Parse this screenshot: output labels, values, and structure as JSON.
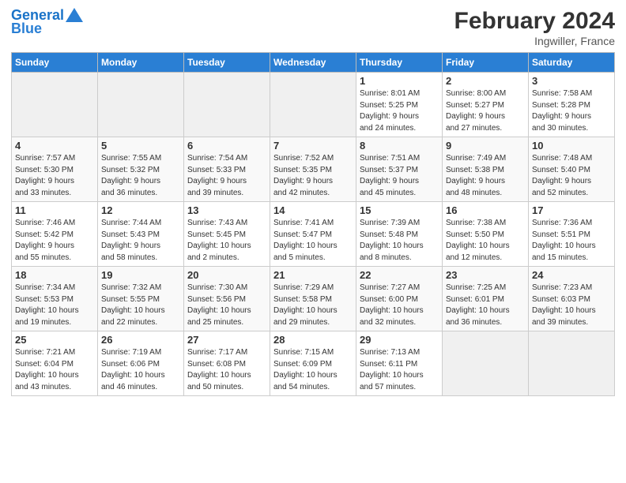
{
  "header": {
    "logo_line1": "General",
    "logo_line2": "Blue",
    "month_title": "February 2024",
    "location": "Ingwiller, France"
  },
  "days_of_week": [
    "Sunday",
    "Monday",
    "Tuesday",
    "Wednesday",
    "Thursday",
    "Friday",
    "Saturday"
  ],
  "weeks": [
    [
      {
        "day": "",
        "info": ""
      },
      {
        "day": "",
        "info": ""
      },
      {
        "day": "",
        "info": ""
      },
      {
        "day": "",
        "info": ""
      },
      {
        "day": "1",
        "info": "Sunrise: 8:01 AM\nSunset: 5:25 PM\nDaylight: 9 hours\nand 24 minutes."
      },
      {
        "day": "2",
        "info": "Sunrise: 8:00 AM\nSunset: 5:27 PM\nDaylight: 9 hours\nand 27 minutes."
      },
      {
        "day": "3",
        "info": "Sunrise: 7:58 AM\nSunset: 5:28 PM\nDaylight: 9 hours\nand 30 minutes."
      }
    ],
    [
      {
        "day": "4",
        "info": "Sunrise: 7:57 AM\nSunset: 5:30 PM\nDaylight: 9 hours\nand 33 minutes."
      },
      {
        "day": "5",
        "info": "Sunrise: 7:55 AM\nSunset: 5:32 PM\nDaylight: 9 hours\nand 36 minutes."
      },
      {
        "day": "6",
        "info": "Sunrise: 7:54 AM\nSunset: 5:33 PM\nDaylight: 9 hours\nand 39 minutes."
      },
      {
        "day": "7",
        "info": "Sunrise: 7:52 AM\nSunset: 5:35 PM\nDaylight: 9 hours\nand 42 minutes."
      },
      {
        "day": "8",
        "info": "Sunrise: 7:51 AM\nSunset: 5:37 PM\nDaylight: 9 hours\nand 45 minutes."
      },
      {
        "day": "9",
        "info": "Sunrise: 7:49 AM\nSunset: 5:38 PM\nDaylight: 9 hours\nand 48 minutes."
      },
      {
        "day": "10",
        "info": "Sunrise: 7:48 AM\nSunset: 5:40 PM\nDaylight: 9 hours\nand 52 minutes."
      }
    ],
    [
      {
        "day": "11",
        "info": "Sunrise: 7:46 AM\nSunset: 5:42 PM\nDaylight: 9 hours\nand 55 minutes."
      },
      {
        "day": "12",
        "info": "Sunrise: 7:44 AM\nSunset: 5:43 PM\nDaylight: 9 hours\nand 58 minutes."
      },
      {
        "day": "13",
        "info": "Sunrise: 7:43 AM\nSunset: 5:45 PM\nDaylight: 10 hours\nand 2 minutes."
      },
      {
        "day": "14",
        "info": "Sunrise: 7:41 AM\nSunset: 5:47 PM\nDaylight: 10 hours\nand 5 minutes."
      },
      {
        "day": "15",
        "info": "Sunrise: 7:39 AM\nSunset: 5:48 PM\nDaylight: 10 hours\nand 8 minutes."
      },
      {
        "day": "16",
        "info": "Sunrise: 7:38 AM\nSunset: 5:50 PM\nDaylight: 10 hours\nand 12 minutes."
      },
      {
        "day": "17",
        "info": "Sunrise: 7:36 AM\nSunset: 5:51 PM\nDaylight: 10 hours\nand 15 minutes."
      }
    ],
    [
      {
        "day": "18",
        "info": "Sunrise: 7:34 AM\nSunset: 5:53 PM\nDaylight: 10 hours\nand 19 minutes."
      },
      {
        "day": "19",
        "info": "Sunrise: 7:32 AM\nSunset: 5:55 PM\nDaylight: 10 hours\nand 22 minutes."
      },
      {
        "day": "20",
        "info": "Sunrise: 7:30 AM\nSunset: 5:56 PM\nDaylight: 10 hours\nand 25 minutes."
      },
      {
        "day": "21",
        "info": "Sunrise: 7:29 AM\nSunset: 5:58 PM\nDaylight: 10 hours\nand 29 minutes."
      },
      {
        "day": "22",
        "info": "Sunrise: 7:27 AM\nSunset: 6:00 PM\nDaylight: 10 hours\nand 32 minutes."
      },
      {
        "day": "23",
        "info": "Sunrise: 7:25 AM\nSunset: 6:01 PM\nDaylight: 10 hours\nand 36 minutes."
      },
      {
        "day": "24",
        "info": "Sunrise: 7:23 AM\nSunset: 6:03 PM\nDaylight: 10 hours\nand 39 minutes."
      }
    ],
    [
      {
        "day": "25",
        "info": "Sunrise: 7:21 AM\nSunset: 6:04 PM\nDaylight: 10 hours\nand 43 minutes."
      },
      {
        "day": "26",
        "info": "Sunrise: 7:19 AM\nSunset: 6:06 PM\nDaylight: 10 hours\nand 46 minutes."
      },
      {
        "day": "27",
        "info": "Sunrise: 7:17 AM\nSunset: 6:08 PM\nDaylight: 10 hours\nand 50 minutes."
      },
      {
        "day": "28",
        "info": "Sunrise: 7:15 AM\nSunset: 6:09 PM\nDaylight: 10 hours\nand 54 minutes."
      },
      {
        "day": "29",
        "info": "Sunrise: 7:13 AM\nSunset: 6:11 PM\nDaylight: 10 hours\nand 57 minutes."
      },
      {
        "day": "",
        "info": ""
      },
      {
        "day": "",
        "info": ""
      }
    ]
  ]
}
